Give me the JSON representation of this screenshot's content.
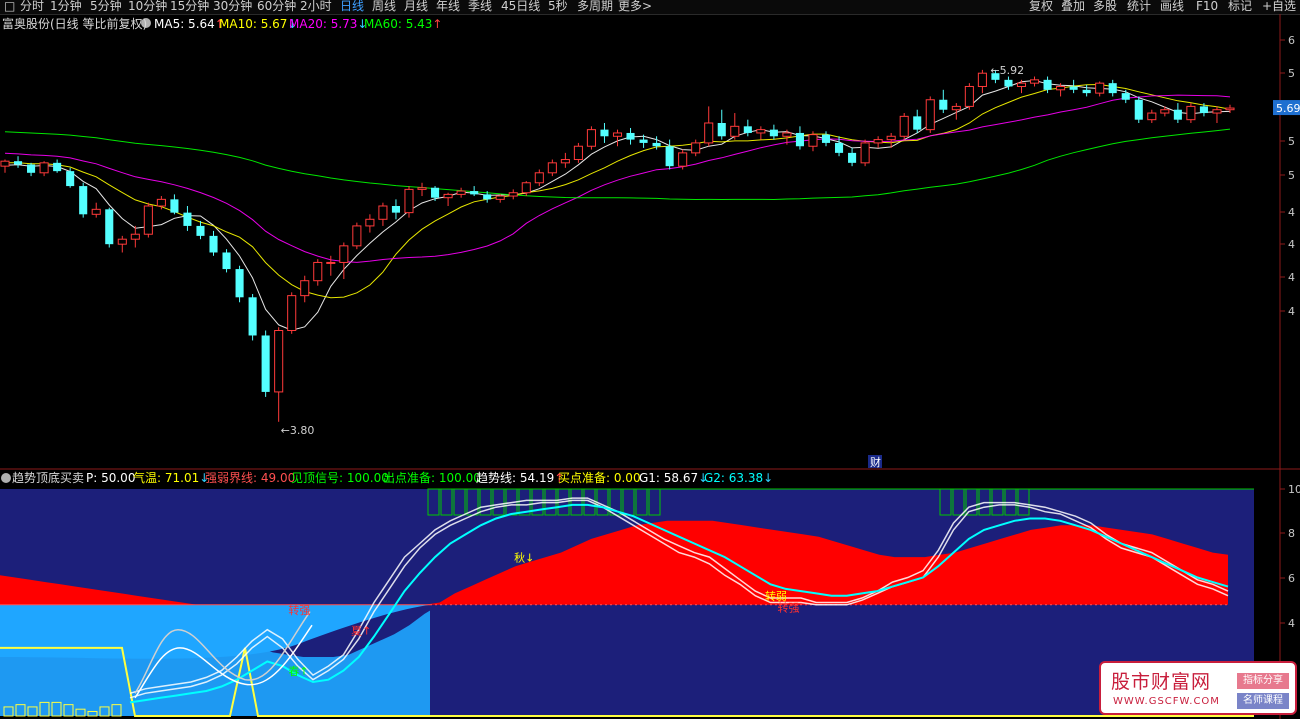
{
  "toolbar": {
    "periods": [
      "分时",
      "1分钟",
      "5分钟",
      "10分钟",
      "15分钟",
      "30分钟",
      "60分钟",
      "2小时",
      "日线",
      "周线",
      "月线",
      "年线",
      "季线",
      "45日线",
      "5秒",
      "多周期",
      "更多>"
    ],
    "active_index": 8,
    "right_buttons": [
      "复权",
      "叠加",
      "多股",
      "统计",
      "画线",
      "F10",
      "标记",
      "+自选"
    ]
  },
  "main_header": {
    "title": "富奥股份(日线 等比前复权)",
    "indicators": [
      {
        "label": "MA5: 5.64",
        "arrow": "↑",
        "color": "#ffffff"
      },
      {
        "label": "MA10: 5.67",
        "arrow": "↓",
        "color": "#ffff00"
      },
      {
        "label": "MA20: 5.73",
        "arrow": "↓",
        "color": "#ff00ff"
      },
      {
        "label": "MA60: 5.43",
        "arrow": "↑",
        "color": "#00ff00"
      }
    ]
  },
  "sub_header": {
    "title": "趋势顶底买卖",
    "indicators": [
      {
        "label": "P: 50.00",
        "arrow": "",
        "color": "#ffffff"
      },
      {
        "label": "气温: 71.01",
        "arrow": "↓",
        "color": "#ffff00"
      },
      {
        "label": "强弱界线: 49.00",
        "arrow": "",
        "color": "#ff5050"
      },
      {
        "label": "见顶信号: 100.00",
        "arrow": "",
        "color": "#00ff00"
      },
      {
        "label": "出点准备: 100.00",
        "arrow": "",
        "color": "#00ff00"
      },
      {
        "label": "趋势线: 54.19",
        "arrow": "↑",
        "color": "#ffffff"
      },
      {
        "label": "买点准备: 0.00",
        "arrow": "",
        "color": "#ffff00"
      },
      {
        "label": "G1: 58.67",
        "arrow": "↓",
        "color": "#ffffff"
      },
      {
        "label": "G2: 63.38",
        "arrow": "↓",
        "color": "#00ffff"
      }
    ]
  },
  "chart_data": [
    {
      "type": "candlestick",
      "price_axis": {
        "ylim": [
          3.6,
          6.1
        ],
        "current_price_label": "5.69",
        "tick_labels_visible": [
          "6",
          "5",
          "5",
          "5",
          "5",
          "4",
          "4",
          "4",
          "4"
        ]
      },
      "annotations": {
        "high_label": "5.92",
        "low_label": "3.80",
        "event_marker": "财"
      },
      "ma_series": [
        {
          "name": "MA5",
          "color": "#ffffff"
        },
        {
          "name": "MA10",
          "color": "#ffff00"
        },
        {
          "name": "MA20",
          "color": "#ff00ff"
        },
        {
          "name": "MA60",
          "color": "#00ff00"
        }
      ],
      "candles": [
        [
          5.34,
          5.38,
          5.3,
          5.37
        ],
        [
          5.37,
          5.4,
          5.33,
          5.35
        ],
        [
          5.35,
          5.36,
          5.28,
          5.3
        ],
        [
          5.3,
          5.37,
          5.28,
          5.36
        ],
        [
          5.36,
          5.38,
          5.3,
          5.31
        ],
        [
          5.31,
          5.33,
          5.21,
          5.22
        ],
        [
          5.22,
          5.24,
          5.03,
          5.05
        ],
        [
          5.05,
          5.12,
          5.03,
          5.08
        ],
        [
          5.08,
          5.09,
          4.85,
          4.87
        ],
        [
          4.87,
          4.92,
          4.82,
          4.9
        ],
        [
          4.9,
          4.98,
          4.85,
          4.93
        ],
        [
          4.93,
          5.12,
          4.91,
          5.1
        ],
        [
          5.1,
          5.16,
          5.08,
          5.14
        ],
        [
          5.14,
          5.17,
          5.05,
          5.06
        ],
        [
          5.06,
          5.1,
          4.95,
          4.98
        ],
        [
          4.98,
          5.01,
          4.9,
          4.92
        ],
        [
          4.92,
          4.95,
          4.8,
          4.82
        ],
        [
          4.82,
          4.84,
          4.7,
          4.72
        ],
        [
          4.72,
          4.74,
          4.52,
          4.55
        ],
        [
          4.55,
          4.57,
          4.29,
          4.32
        ],
        [
          4.32,
          4.35,
          3.95,
          3.98
        ],
        [
          3.98,
          4.37,
          3.8,
          4.35
        ],
        [
          4.35,
          4.58,
          4.33,
          4.56
        ],
        [
          4.56,
          4.68,
          4.52,
          4.65
        ],
        [
          4.65,
          4.78,
          4.62,
          4.76
        ],
        [
          4.76,
          4.8,
          4.68,
          4.76
        ],
        [
          4.76,
          4.88,
          4.66,
          4.86
        ],
        [
          4.86,
          5.0,
          4.84,
          4.98
        ],
        [
          4.98,
          5.05,
          4.94,
          5.02
        ],
        [
          5.02,
          5.12,
          4.98,
          5.1
        ],
        [
          5.1,
          5.14,
          5.02,
          5.06
        ],
        [
          5.06,
          5.22,
          5.03,
          5.2
        ],
        [
          5.2,
          5.24,
          5.16,
          5.21
        ],
        [
          5.21,
          5.22,
          5.13,
          5.15
        ],
        [
          5.15,
          5.18,
          5.1,
          5.17
        ],
        [
          5.17,
          5.21,
          5.15,
          5.19
        ],
        [
          5.19,
          5.22,
          5.16,
          5.17
        ],
        [
          5.17,
          5.19,
          5.12,
          5.14
        ],
        [
          5.14,
          5.17,
          5.12,
          5.16
        ],
        [
          5.16,
          5.2,
          5.14,
          5.18
        ],
        [
          5.18,
          5.25,
          5.16,
          5.24
        ],
        [
          5.24,
          5.32,
          5.22,
          5.3
        ],
        [
          5.3,
          5.38,
          5.28,
          5.36
        ],
        [
          5.36,
          5.42,
          5.33,
          5.38
        ],
        [
          5.38,
          5.48,
          5.36,
          5.46
        ],
        [
          5.46,
          5.58,
          5.44,
          5.56
        ],
        [
          5.56,
          5.6,
          5.48,
          5.52
        ],
        [
          5.52,
          5.56,
          5.46,
          5.54
        ],
        [
          5.54,
          5.57,
          5.47,
          5.5
        ],
        [
          5.5,
          5.53,
          5.45,
          5.48
        ],
        [
          5.48,
          5.52,
          5.44,
          5.46
        ],
        [
          5.46,
          5.5,
          5.32,
          5.34
        ],
        [
          5.34,
          5.44,
          5.32,
          5.42
        ],
        [
          5.42,
          5.5,
          5.4,
          5.48
        ],
        [
          5.48,
          5.7,
          5.46,
          5.6
        ],
        [
          5.6,
          5.68,
          5.5,
          5.52
        ],
        [
          5.52,
          5.66,
          5.5,
          5.58
        ],
        [
          5.58,
          5.62,
          5.52,
          5.54
        ],
        [
          5.54,
          5.58,
          5.5,
          5.56
        ],
        [
          5.56,
          5.59,
          5.5,
          5.52
        ],
        [
          5.52,
          5.56,
          5.47,
          5.54
        ],
        [
          5.54,
          5.58,
          5.44,
          5.46
        ],
        [
          5.46,
          5.55,
          5.43,
          5.53
        ],
        [
          5.53,
          5.55,
          5.46,
          5.48
        ],
        [
          5.48,
          5.52,
          5.4,
          5.42
        ],
        [
          5.42,
          5.45,
          5.34,
          5.36
        ],
        [
          5.36,
          5.5,
          5.34,
          5.48
        ],
        [
          5.48,
          5.52,
          5.45,
          5.5
        ],
        [
          5.5,
          5.54,
          5.45,
          5.52
        ],
        [
          5.52,
          5.66,
          5.5,
          5.64
        ],
        [
          5.64,
          5.68,
          5.54,
          5.56
        ],
        [
          5.56,
          5.76,
          5.54,
          5.74
        ],
        [
          5.74,
          5.8,
          5.66,
          5.68
        ],
        [
          5.68,
          5.72,
          5.62,
          5.7
        ],
        [
          5.7,
          5.84,
          5.68,
          5.82
        ],
        [
          5.82,
          5.92,
          5.78,
          5.9
        ],
        [
          5.9,
          5.92,
          5.84,
          5.86
        ],
        [
          5.86,
          5.88,
          5.8,
          5.82
        ],
        [
          5.82,
          5.86,
          5.78,
          5.84
        ],
        [
          5.84,
          5.88,
          5.82,
          5.86
        ],
        [
          5.86,
          5.88,
          5.78,
          5.8
        ],
        [
          5.8,
          5.84,
          5.76,
          5.82
        ],
        [
          5.82,
          5.86,
          5.78,
          5.8
        ],
        [
          5.8,
          5.83,
          5.76,
          5.78
        ],
        [
          5.78,
          5.85,
          5.76,
          5.84
        ],
        [
          5.84,
          5.86,
          5.76,
          5.78
        ],
        [
          5.78,
          5.8,
          5.72,
          5.74
        ],
        [
          5.74,
          5.76,
          5.6,
          5.62
        ],
        [
          5.62,
          5.68,
          5.6,
          5.66
        ],
        [
          5.66,
          5.7,
          5.64,
          5.68
        ],
        [
          5.68,
          5.72,
          5.6,
          5.62
        ],
        [
          5.62,
          5.72,
          5.6,
          5.7
        ],
        [
          5.7,
          5.72,
          5.64,
          5.66
        ],
        [
          5.66,
          5.7,
          5.6,
          5.68
        ],
        [
          5.68,
          5.71,
          5.66,
          5.69
        ]
      ]
    },
    {
      "type": "area",
      "title": "趋势顶底买卖",
      "ylim": [
        0,
        100
      ],
      "threshold": 49,
      "y_tick_labels": [
        "10",
        "8",
        "6",
        "4",
        "2"
      ],
      "season_labels": [
        {
          "text": "秋↓",
          "color": "#ffff00",
          "x": 41,
          "y": 68
        },
        {
          "text": "夏↑",
          "color": "#ff3030",
          "x": 28,
          "y": 36
        },
        {
          "text": "春↑",
          "color": "#00ff00",
          "x": 23,
          "y": 18
        },
        {
          "text": "转强",
          "color": "#ff3030",
          "x": 23,
          "y": 45
        },
        {
          "text": "转弱",
          "color": "#ffff00",
          "x": 61,
          "y": 51
        },
        {
          "text": "转强",
          "color": "#ff3030",
          "x": 62,
          "y": 46
        }
      ],
      "temperature": [
        62,
        61,
        60,
        59,
        58,
        57,
        56,
        55,
        54,
        53,
        52,
        51,
        50,
        46,
        40,
        36,
        32,
        30,
        28,
        27,
        26,
        26,
        26,
        27,
        30,
        33,
        36,
        40,
        45,
        50,
        54,
        57,
        60,
        63,
        66,
        68,
        70,
        72,
        75,
        78,
        80,
        82,
        84,
        85,
        86,
        86,
        86,
        86,
        85,
        84,
        83,
        82,
        81,
        80,
        79,
        77,
        75,
        73,
        71,
        70,
        70,
        70,
        71,
        72,
        74,
        76,
        78,
        80,
        82,
        83,
        84,
        84,
        84,
        83,
        82,
        81,
        80,
        78,
        76,
        74,
        72,
        71
      ],
      "series": [
        {
          "name": "趋势线",
          "color": "#ffffff",
          "values": [
            10,
            12,
            13,
            14,
            15,
            17,
            20,
            26,
            33,
            38,
            34,
            25,
            18,
            22,
            27,
            38,
            50,
            60,
            70,
            76,
            82,
            86,
            89,
            92,
            93,
            94,
            95,
            95,
            95,
            96,
            96,
            93,
            90,
            86,
            82,
            78,
            75,
            72,
            70,
            65,
            60,
            55,
            52,
            52,
            52,
            50,
            50,
            50,
            52,
            55,
            59,
            61,
            64,
            73,
            85,
            92,
            94,
            94,
            94,
            93,
            92,
            90,
            88,
            85,
            80,
            76,
            74,
            72,
            68,
            64,
            60,
            58,
            55
          ]
        },
        {
          "name": "G1",
          "color": "#ffffff",
          "values": [
            8,
            10,
            11,
            12,
            13,
            15,
            18,
            23,
            30,
            35,
            30,
            22,
            16,
            20,
            25,
            34,
            46,
            56,
            66,
            74,
            80,
            84,
            87,
            90,
            92,
            93,
            93,
            94,
            94,
            95,
            95,
            92,
            88,
            84,
            80,
            76,
            72,
            70,
            67,
            62,
            58,
            53,
            50,
            50,
            50,
            49,
            49,
            49,
            51,
            54,
            57,
            59,
            61,
            70,
            82,
            90,
            92,
            93,
            93,
            92,
            90,
            89,
            86,
            83,
            78,
            74,
            72,
            70,
            66,
            62,
            58,
            56,
            53
          ]
        },
        {
          "name": "G2",
          "color": "#00ffff",
          "values": [
            6,
            7,
            8,
            9,
            10,
            11,
            13,
            16,
            20,
            24,
            22,
            18,
            15,
            16,
            20,
            26,
            35,
            45,
            55,
            63,
            70,
            76,
            80,
            84,
            87,
            89,
            90,
            91,
            92,
            93,
            93,
            92,
            90,
            88,
            85,
            82,
            79,
            76,
            73,
            70,
            66,
            62,
            58,
            56,
            55,
            54,
            53,
            53,
            54,
            55,
            57,
            59,
            61,
            66,
            72,
            78,
            82,
            84,
            86,
            87,
            87,
            86,
            84,
            82,
            79,
            76,
            73,
            70,
            67,
            64,
            61,
            59,
            57
          ]
        }
      ],
      "buy_prep_markers": [
        4,
        5,
        4,
        6,
        6,
        5,
        3,
        2,
        4,
        5
      ]
    }
  ],
  "watermark": {
    "main": "股市财富网",
    "url": "WWW.GSCFW.COM",
    "tag1": "指标分享",
    "tag2": "名师课程"
  }
}
